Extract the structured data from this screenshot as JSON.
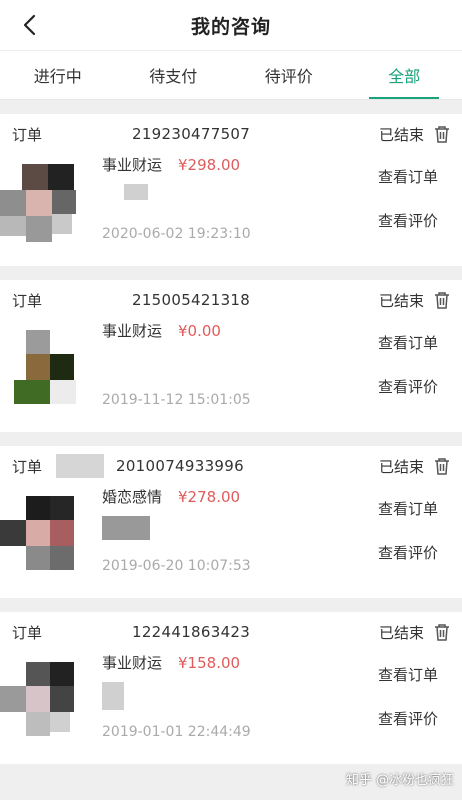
{
  "header": {
    "title": "我的咨询"
  },
  "tabs": [
    {
      "label": "进行中",
      "active": false
    },
    {
      "label": "待支付",
      "active": false
    },
    {
      "label": "待评价",
      "active": false
    },
    {
      "label": "全部",
      "active": true
    }
  ],
  "orders": [
    {
      "order_label": "订单",
      "order_number": "219230477507",
      "status": "已结束",
      "category": "事业财运",
      "price": "¥298.00",
      "date": "2020-06-02 19:23:10",
      "view_order": "查看订单",
      "view_review": "查看评价"
    },
    {
      "order_label": "订单",
      "order_number": "215005421318",
      "status": "已结束",
      "category": "事业财运",
      "price": "¥0.00",
      "date": "2019-11-12 15:01:05",
      "view_order": "查看订单",
      "view_review": "查看评价"
    },
    {
      "order_label": "订单",
      "order_number": "2010074933996",
      "status": "已结束",
      "category": "婚恋感情",
      "price": "¥278.00",
      "date": "2019-06-20 10:07:53",
      "view_order": "查看订单",
      "view_review": "查看评价"
    },
    {
      "order_label": "订单",
      "order_number": "122441863423",
      "status": "已结束",
      "category": "事业财运",
      "price": "¥158.00",
      "date": "2019-01-01 22:44:49",
      "view_order": "查看订单",
      "view_review": "查看评价"
    }
  ],
  "watermark": {
    "text": "知乎 @冰粉也疯狂"
  },
  "colors": {
    "accent": "#1aa37a",
    "price": "#e05b5b"
  },
  "icons": {
    "back": "chevron-left-icon",
    "trash": "trash-icon"
  }
}
